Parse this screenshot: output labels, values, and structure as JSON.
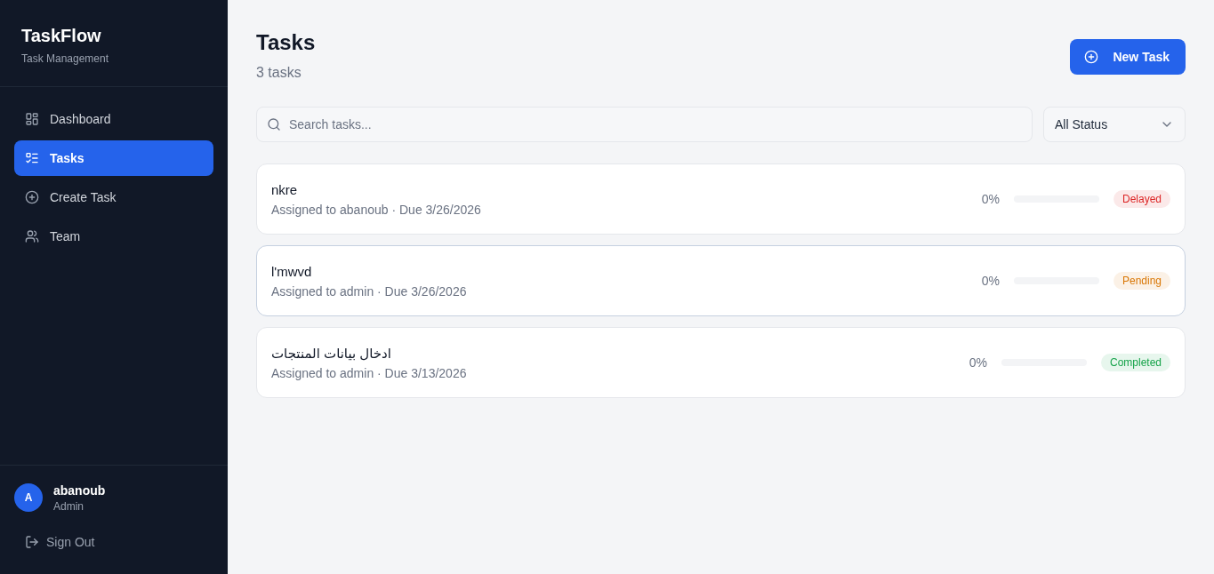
{
  "sidebar": {
    "brand": {
      "title": "TaskFlow",
      "subtitle": "Task Management"
    },
    "nav": [
      {
        "label": "Dashboard",
        "selected": false
      },
      {
        "label": "Tasks",
        "selected": true
      },
      {
        "label": "Create Task",
        "selected": false
      },
      {
        "label": "Team",
        "selected": false
      }
    ],
    "user": {
      "initial": "A",
      "name": "abanoub",
      "role": "Admin"
    },
    "sign_out": "Sign Out"
  },
  "header": {
    "title": "Tasks",
    "count": "3 tasks",
    "new_button": "New Task"
  },
  "filters": {
    "search": {
      "placeholder": "Search tasks..."
    },
    "status_select": {
      "value": "All Status"
    }
  },
  "tasks": [
    {
      "title": "nkre",
      "meta": "Assigned to abanoub · Due 3/26/2026",
      "percent": "0%",
      "status": "Delayed",
      "color": "#dc2626",
      "hovered": false
    },
    {
      "title": "l'mwvd",
      "meta": "Assigned to admin · Due 3/26/2026",
      "percent": "0%",
      "status": "Pending",
      "color": "#d97706",
      "hovered": true
    },
    {
      "title": "ادخال بيانات المنتجات",
      "meta": "Assigned to admin · Due 3/13/2026",
      "percent": "0%",
      "status": "Completed",
      "color": "#16a34a",
      "hovered": false
    }
  ]
}
